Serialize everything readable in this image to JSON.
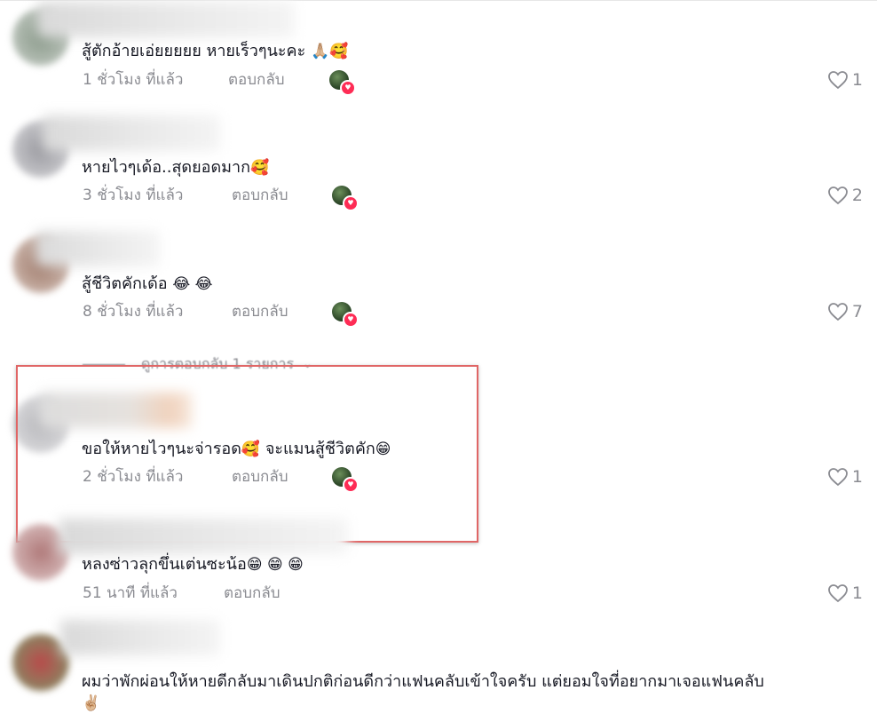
{
  "comments": [
    {
      "text": "สู้ตักอ้ายเอ่ยยยยย หายเร็วๆนะคะ",
      "emoji": "🙏🏼🥰",
      "time": "1 ชั่วโมง ที่แล้ว",
      "reply": "ตอบกลับ",
      "likes": "1"
    },
    {
      "text": "หายไวๆเด้อ..สุดยอดมาก",
      "emoji": "🥰",
      "time": "3 ชั่วโมง ที่แล้ว",
      "reply": "ตอบกลับ",
      "likes": "2"
    },
    {
      "text": "สู้ชีวิตคักเด้อ",
      "emoji": "😂 😂",
      "time": "8 ชั่วโมง ที่แล้ว",
      "reply": "ตอบกลับ",
      "likes": "7"
    },
    {
      "text_a": "ขอให้หายไวๆนะจ่ารอด",
      "emoji_a": "🥰",
      "text_b": "จะแมนสู้ชีวิตคัก",
      "emoji_b": "😁",
      "time": "2 ชั่วโมง ที่แล้ว",
      "reply": "ตอบกลับ",
      "likes": "1"
    },
    {
      "text": "หลงซ่าวลุกขึ่นเต่นซะน้อ",
      "emoji": "😁 😁 😁",
      "time": "51 นาที ที่แล้ว",
      "reply": "ตอบกลับ",
      "likes": "1"
    },
    {
      "text": "ผมว่าพักผ่อนให้หายดีกลับมาเดินปกติก่อนดีกว่าแฟนคลับเข้าใจครับ แต่ยอมใจที่อยากมาเจอแฟนคลับ",
      "emoji": "✌🏼"
    }
  ],
  "view_replies": {
    "label": "ดูการตอบกลับ 1 รายการ"
  },
  "colors": {
    "accent_highlight": "#e06666",
    "like_gray": "#8a8b91",
    "creator_badge": "#fe2c55"
  }
}
